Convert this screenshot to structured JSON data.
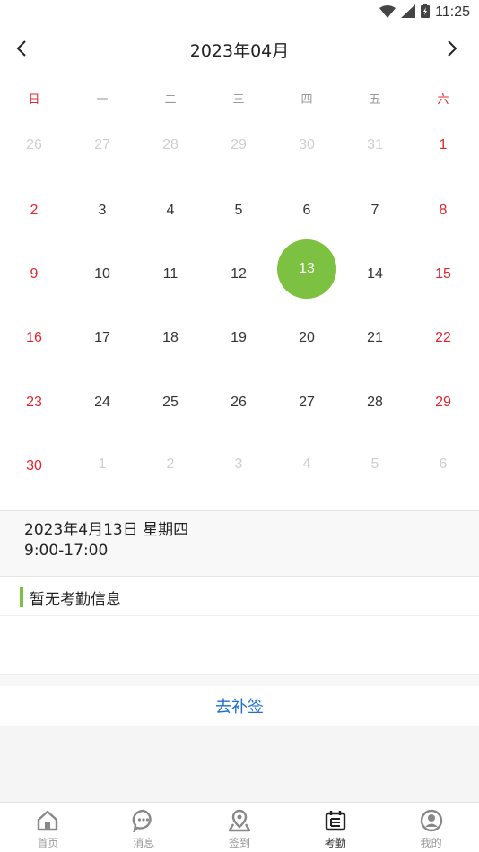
{
  "status_bar": {
    "time": "11:25"
  },
  "header": {
    "month_title": "2023年04月"
  },
  "weekdays": [
    "日",
    "一",
    "二",
    "三",
    "四",
    "五",
    "六"
  ],
  "calendar": {
    "rows": [
      [
        "26",
        "27",
        "28",
        "29",
        "30",
        "31",
        "1"
      ],
      [
        "2",
        "3",
        "4",
        "5",
        "6",
        "7",
        "8"
      ],
      [
        "9",
        "10",
        "11",
        "12",
        "13",
        "14",
        "15"
      ],
      [
        "16",
        "17",
        "18",
        "19",
        "20",
        "21",
        "22"
      ],
      [
        "23",
        "24",
        "25",
        "26",
        "27",
        "28",
        "29"
      ],
      [
        "30",
        "1",
        "2",
        "3",
        "4",
        "5",
        "6"
      ]
    ],
    "selected": "13",
    "accent_color": "#7cc142",
    "weekend_color": "#e0252f"
  },
  "info": {
    "date": "2023年4月13日 星期四",
    "hours": "9:00-17:00"
  },
  "records": {
    "title": "暂无考勤信息"
  },
  "supplement": {
    "label": "去补签",
    "color": "#1e6fcf"
  },
  "tabbar": {
    "items": [
      {
        "label": "首页",
        "icon": "home-icon"
      },
      {
        "label": "消息",
        "icon": "message-icon"
      },
      {
        "label": "签到",
        "icon": "map-pin-icon"
      },
      {
        "label": "考勤",
        "icon": "attendance-icon"
      },
      {
        "label": "我的",
        "icon": "profile-icon"
      }
    ],
    "active": "考勤"
  }
}
